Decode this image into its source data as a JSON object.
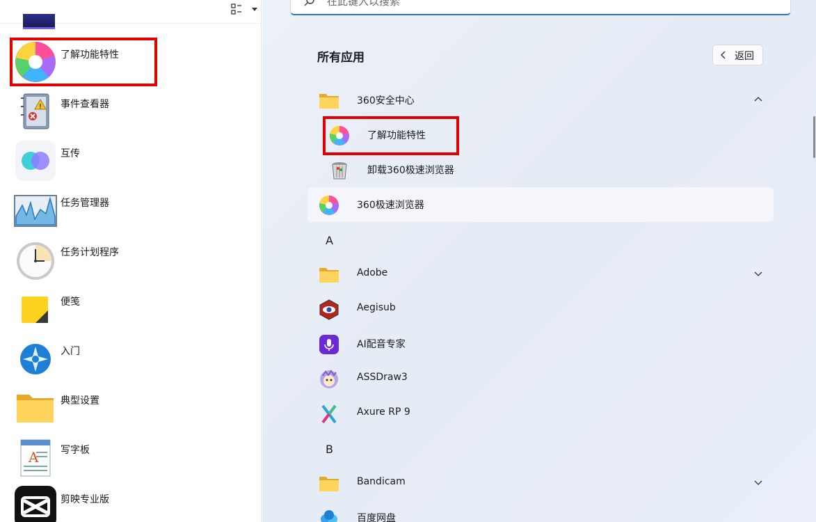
{
  "left_panel": {
    "items": [
      {
        "label": "了解功能特性",
        "icon": "360-browser-icon"
      },
      {
        "label": "事件查看器",
        "icon": "event-viewer-icon"
      },
      {
        "label": "互传",
        "icon": "transfer-icon"
      },
      {
        "label": "任务管理器",
        "icon": "task-manager-icon"
      },
      {
        "label": "任务计划程序",
        "icon": "clock-icon"
      },
      {
        "label": "便笺",
        "icon": "sticky-notes-icon"
      },
      {
        "label": "入门",
        "icon": "get-started-icon"
      },
      {
        "label": "典型设置",
        "icon": "folder-icon"
      },
      {
        "label": "写字板",
        "icon": "wordpad-icon"
      },
      {
        "label": "剪映专业版",
        "icon": "capcut-icon"
      }
    ]
  },
  "right_panel": {
    "search_placeholder": "在此键入以搜索",
    "title": "所有应用",
    "back_label": "返回",
    "groups": [
      {
        "label": "360安全中心",
        "icon": "folder-icon",
        "expanded": true
      },
      {
        "label": "Adobe",
        "icon": "folder-icon",
        "expanded": false
      },
      {
        "label": "Bandicam",
        "icon": "folder-icon",
        "expanded": false
      }
    ],
    "sub_items": [
      {
        "label": "了解功能特性",
        "icon": "360-browser-icon"
      },
      {
        "label": "卸载360极速浏览器",
        "icon": "uninstall-icon"
      }
    ],
    "apps": [
      {
        "label": "360极速浏览器",
        "icon": "360-browser-icon"
      },
      {
        "label": "Aegisub",
        "icon": "aegisub-icon"
      },
      {
        "label": "AI配音专家",
        "icon": "microphone-icon"
      },
      {
        "label": "ASSDraw3",
        "icon": "assdraw-icon"
      },
      {
        "label": "Axure RP 9",
        "icon": "axure-icon"
      },
      {
        "label": "百度网盘",
        "icon": "baidu-netdisk-icon"
      }
    ],
    "letters": [
      "A",
      "B"
    ]
  },
  "colors": {
    "highlight_red": "#e00000",
    "accent_blue": "#2f6fd0",
    "folder_yellow": "#f5c342"
  }
}
